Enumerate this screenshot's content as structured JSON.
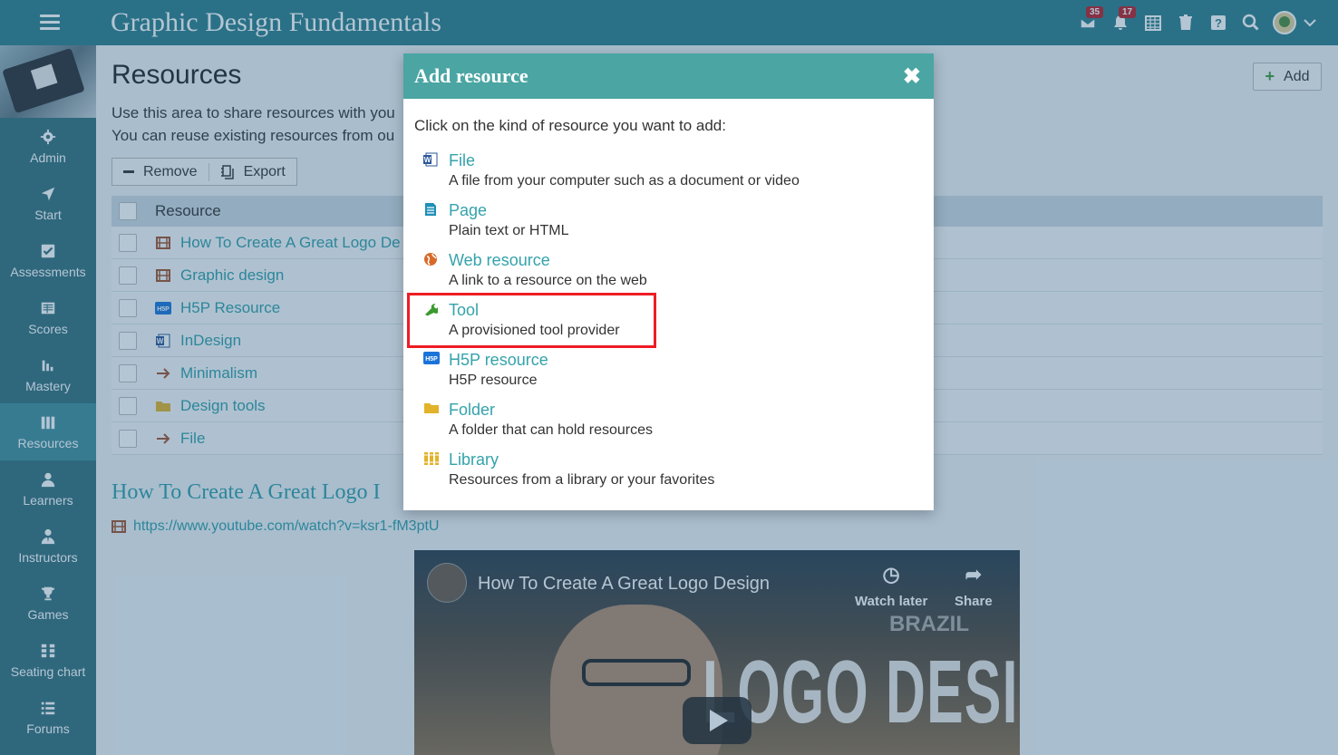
{
  "app": {
    "title": "Graphic Design Fundamentals"
  },
  "topbar": {
    "badges": {
      "messages": "35",
      "notifications": "17"
    },
    "icons": [
      "mail-icon",
      "bell-icon",
      "calendar-icon",
      "trash-icon",
      "help-icon",
      "search-icon",
      "avatar",
      "chevron-down-icon"
    ]
  },
  "sidebar": {
    "items": [
      {
        "label": "Admin",
        "icon": "gear-icon"
      },
      {
        "label": "Start",
        "icon": "navigation-arrow-icon"
      },
      {
        "label": "Assessments",
        "icon": "checkbox-icon"
      },
      {
        "label": "Scores",
        "icon": "gradebook-icon"
      },
      {
        "label": "Mastery",
        "icon": "bar-chart-icon"
      },
      {
        "label": "Resources",
        "icon": "books-icon",
        "active": true
      },
      {
        "label": "Learners",
        "icon": "person-icon"
      },
      {
        "label": "Instructors",
        "icon": "instructor-icon"
      },
      {
        "label": "Games",
        "icon": "trophy-icon"
      },
      {
        "label": "Seating chart",
        "icon": "seating-icon"
      },
      {
        "label": "Forums",
        "icon": "list-icon"
      }
    ]
  },
  "main": {
    "title": "Resources",
    "add_label": "Add",
    "intro_line1": "Use this area to share resources with you",
    "intro_line2": "You can reuse existing resources from ou",
    "toolbar": {
      "remove": "Remove",
      "export": "Export"
    },
    "table": {
      "header": "Resource",
      "rows": [
        {
          "label": "How To Create A Great Logo De",
          "icon": "film-icon"
        },
        {
          "label": "Graphic design",
          "icon": "film-icon"
        },
        {
          "label": "H5P Resource",
          "icon": "h5p-icon"
        },
        {
          "label": "InDesign",
          "icon": "word-doc-icon"
        },
        {
          "label": "Minimalism",
          "icon": "arrow-right-icon"
        },
        {
          "label": "Design tools",
          "icon": "folder-icon"
        },
        {
          "label": "File",
          "icon": "arrow-right-icon"
        }
      ]
    },
    "section_title": "How To Create A Great Logo I",
    "link": "https://www.youtube.com/watch?v=ksr1-fM3ptU",
    "video": {
      "title": "How To Create A Great Logo Design",
      "watch_later": "Watch later",
      "share": "Share",
      "overlay_text": "LOGO DESIGN",
      "overlay_text_2": "BRAZIL"
    }
  },
  "modal": {
    "title": "Add resource",
    "prompt": "Click on the kind of resource you want to add:",
    "options": [
      {
        "name": "File",
        "desc": "A file from your computer such as a document or video",
        "icon": "word-doc-icon"
      },
      {
        "name": "Page",
        "desc": "Plain text or HTML",
        "icon": "page-icon"
      },
      {
        "name": "Web resource",
        "desc": "A link to a resource on the web",
        "icon": "globe-icon"
      },
      {
        "name": "Tool",
        "desc": "A provisioned tool provider",
        "icon": "wrench-icon"
      },
      {
        "name": "H5P resource",
        "desc": "H5P resource",
        "icon": "h5p-icon"
      },
      {
        "name": "Folder",
        "desc": "A folder that can hold resources",
        "icon": "folder-icon"
      },
      {
        "name": "Library",
        "desc": "Resources from a library or your favorites",
        "icon": "books-icon"
      }
    ]
  },
  "colors": {
    "topbar": "#2c7f8a",
    "sidebar": "#33707c",
    "modal_header": "#4aa5a3",
    "link": "#34a3ab",
    "highlight": "#ee1c24"
  }
}
